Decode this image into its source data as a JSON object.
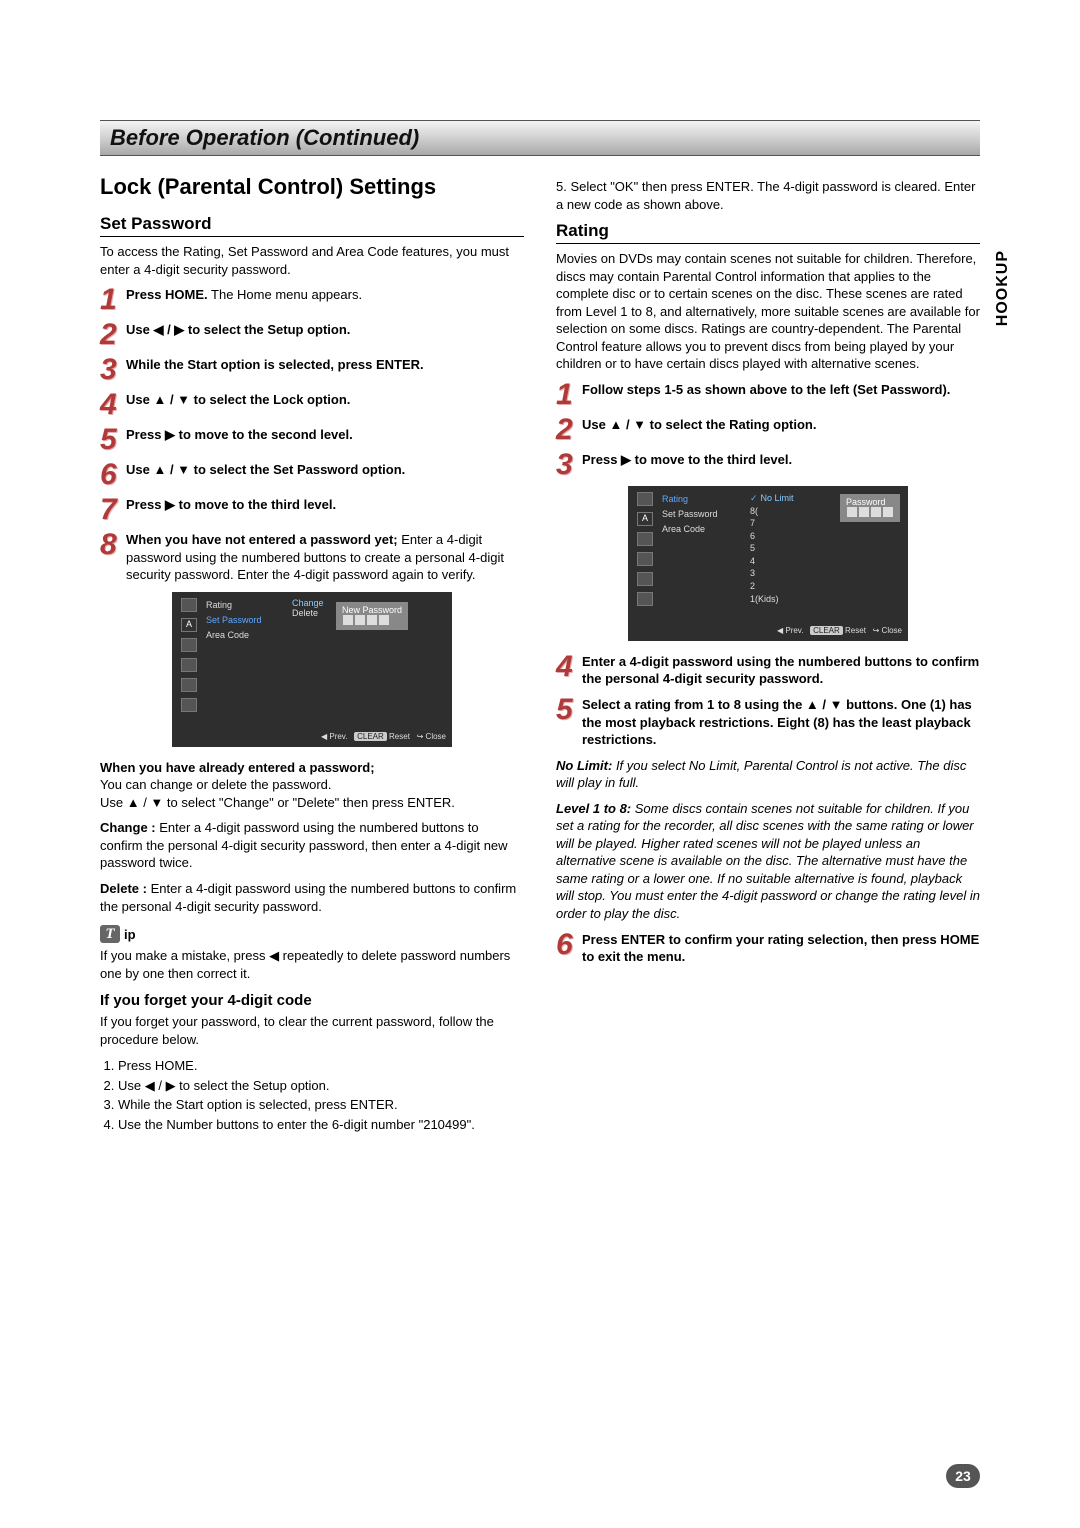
{
  "sideTab": "HOOKUP",
  "pageNumber": "23",
  "headerBar": "Before Operation (Continued)",
  "left": {
    "mainHeading": "Lock (Parental Control) Settings",
    "setPassword": {
      "heading": "Set Password",
      "intro": "To access the Rating, Set Password and Area Code features, you must enter a 4-digit security password.",
      "steps": [
        {
          "n": "1",
          "bold": "Press HOME.",
          "rest": " The Home menu appears."
        },
        {
          "n": "2",
          "bold": "Use ◀ / ▶ to select the Setup option.",
          "rest": ""
        },
        {
          "n": "3",
          "bold": "While the Start option is selected, press ENTER.",
          "rest": ""
        },
        {
          "n": "4",
          "bold": "Use ▲ / ▼ to select the Lock option.",
          "rest": ""
        },
        {
          "n": "5",
          "bold": "Press ▶ to move to the second level.",
          "rest": ""
        },
        {
          "n": "6",
          "bold": "Use ▲ / ▼ to select the Set Password option.",
          "rest": ""
        },
        {
          "n": "7",
          "bold": "Press ▶ to move to the third level.",
          "rest": ""
        },
        {
          "n": "8",
          "bold": "When you have not entered a password yet;",
          "rest": " Enter a 4-digit password using the numbered buttons to create a personal 4-digit security password. Enter the 4-digit password again to verify."
        }
      ],
      "figure": {
        "menu": [
          "Rating",
          "Set Password",
          "Area Code"
        ],
        "changeLabel": "Change",
        "deleteLabel": "Delete",
        "newPw": "New Password",
        "footerPrev": "◀ Prev.",
        "footerReset": "CLEAR Reset",
        "footerClose": "↪ Close"
      },
      "already": {
        "title": "When you have already entered a password;",
        "l1": "You can change or delete the password.",
        "l2": "Use ▲ / ▼ to select \"Change\" or \"Delete\" then press ENTER.",
        "changeLabel": "Change : ",
        "changeText": "Enter a 4-digit password using the numbered buttons to confirm the personal 4-digit security password, then enter a 4-digit new password twice.",
        "deleteLabel": "Delete : ",
        "deleteText": "Enter a 4-digit password using the numbered buttons to confirm the personal 4-digit security password."
      },
      "tip": {
        "iconLetter": "T",
        "label": "ip",
        "text": "If you make a mistake, press ◀ repeatedly to delete password numbers one by one then correct it."
      },
      "forget": {
        "heading": "If you forget your 4-digit code",
        "intro": "If you forget your password, to clear the current password, follow the procedure below.",
        "items": [
          "Press HOME.",
          "Use ◀ / ▶ to select the Setup option.",
          "While the Start option is selected, press ENTER.",
          "Use the Number buttons to enter the 6-digit number \"210499\"."
        ]
      }
    }
  },
  "right": {
    "topStep5": "5.  Select \"OK\" then press ENTER. The 4-digit password is cleared. Enter a new code as shown above.",
    "rating": {
      "heading": "Rating",
      "intro": "Movies on DVDs may contain scenes not suitable for children. Therefore, discs may contain Parental Control information that applies to the complete disc or to certain scenes on the disc. These scenes are rated from Level 1 to 8, and alternatively, more suitable scenes are available for selection on some discs. Ratings are country-dependent. The Parental Control feature allows you to prevent discs from being played by your children or to have certain discs played with alternative scenes.",
      "steps123": [
        {
          "n": "1",
          "bold": "Follow steps 1-5 as shown above to the left (Set Password)."
        },
        {
          "n": "2",
          "bold": "Use ▲ / ▼ to select the Rating option."
        },
        {
          "n": "3",
          "bold": "Press ▶ to move to the third level."
        }
      ],
      "figure": {
        "menu": [
          "Rating",
          "Set Password",
          "Area Code"
        ],
        "levels": [
          "✓ No Limit",
          "8(",
          "7",
          "6",
          "5",
          "4",
          "3",
          "2",
          "1(Kids)"
        ],
        "pwLabel": "Password",
        "footerPrev": "◀ Prev.",
        "footerReset": "CLEAR Reset",
        "footerClose": "↪ Close"
      },
      "steps456": [
        {
          "n": "4",
          "bold": "Enter a 4-digit password using the numbered buttons to confirm the personal 4-digit security password."
        },
        {
          "n": "5",
          "bold": "Select a rating from 1 to 8 using the ▲ / ▼ buttons. One (1) has the most playback restrictions. Eight (8) has the least playback restrictions."
        }
      ],
      "noLimitLabel": "No Limit: ",
      "noLimitText": "If you select No Limit, Parental Control is not active. The disc will play in full.",
      "levelLabel": "Level 1 to 8: ",
      "levelText": "Some discs contain scenes not suitable for children. If you set a rating for the recorder, all disc scenes with the same rating or lower will be played. Higher rated scenes will not be played unless an alternative scene is available on the disc. The alternative must have the same rating or a lower one. If no suitable alternative is found, playback will stop. You must enter the 4-digit password or change the rating level in order to play the disc.",
      "step6": {
        "n": "6",
        "bold": "Press ENTER to confirm your rating selection, then press HOME to exit the menu."
      }
    }
  }
}
